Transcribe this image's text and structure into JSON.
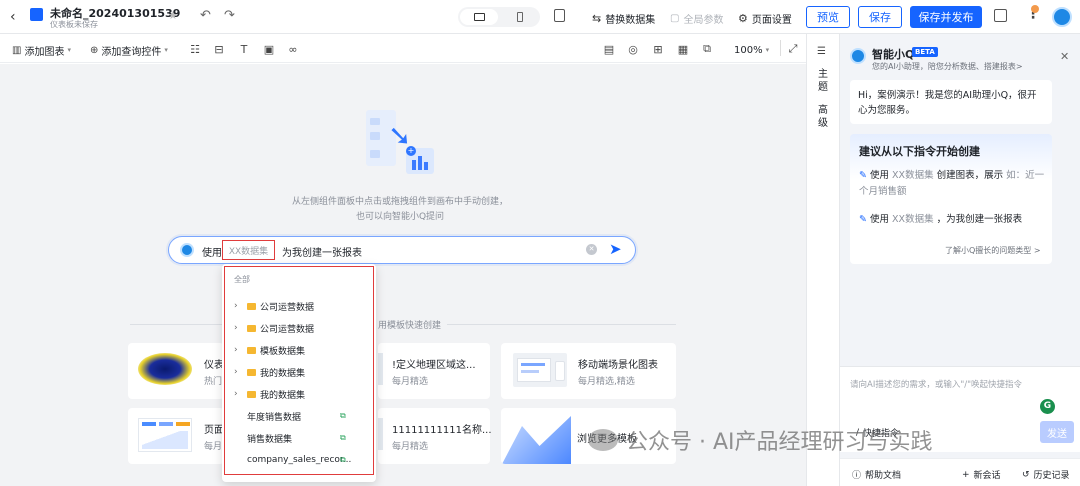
{
  "header": {
    "title": "未命名_202401301539",
    "subtitle": "仪表板未保存",
    "replace_dataset": "替换数据集",
    "global_params": "全局参数",
    "page_settings": "页面设置",
    "preview": "预览",
    "save": "保存",
    "save_publish": "保存并发布"
  },
  "toolbar": {
    "add_chart": "添加图表",
    "add_query": "添加查询控件",
    "zoom": "100%"
  },
  "canvas": {
    "hint_line1": "从左侧组件面板中点击或拖拽组件到画布中手动创建，",
    "hint_line2": "也可以向智能小Q提问",
    "prompt_prefix": "使用",
    "prompt_placeholder": "XX数据集",
    "prompt_suffix": "为我创建一张报表",
    "template_header": "用模板快速创建"
  },
  "dropdown": {
    "header": "全部",
    "items": [
      {
        "label": "公司运营数据",
        "type": "folder"
      },
      {
        "label": "公司运营数据",
        "type": "folder"
      },
      {
        "label": "模板数据集",
        "type": "folder"
      },
      {
        "label": "我的数据集",
        "type": "folder"
      },
      {
        "label": "我的数据集",
        "type": "folder"
      },
      {
        "label": "年度销售数据",
        "type": "table"
      },
      {
        "label": "销售数据集",
        "type": "table"
      },
      {
        "label": "company_sales_recor...",
        "type": "table"
      }
    ]
  },
  "templates": [
    {
      "title": "仪表",
      "sub": "热门"
    },
    {
      "title": "!定义地理区域这...",
      "sub": "每月精选"
    },
    {
      "title": "移动端场景化图表",
      "sub": "每月精选,精选"
    },
    {
      "title": "页面",
      "sub": "每月"
    },
    {
      "title": "11111111111名称...",
      "sub": "每月精选"
    },
    {
      "title": "浏览更多模板",
      "sub": ""
    }
  ],
  "sidebar": {
    "theme": "主题",
    "advanced": "高级"
  },
  "assistant": {
    "title": "智能小Q",
    "badge": "BETA",
    "subtitle": "您的AI小助理，陪您分析数据、搭建报表>",
    "greeting": "Hi，案例演示！我是您的AI助理小Q，很开心为您服务。",
    "suggest_title": "建议从以下指令开始创建",
    "suggest1_prefix": "使用",
    "suggest1_dataset": "XX数据集",
    "suggest1_mid": "创建图表，展示",
    "suggest1_hint": "如：近一个月销售额",
    "suggest2_prefix": "使用",
    "suggest2_dataset": "XX数据集",
    "suggest2_mid": "，为我创建一张报表",
    "learn_more": "了解小Q擅长的问题类型 >",
    "input_placeholder": "请向AI描述您的需求，或输入\"/\"唤起快捷指令",
    "shortcut": "快捷指令",
    "send": "发送",
    "help": "帮助文档",
    "new_chat": "新会话",
    "history": "历史记录"
  },
  "watermark": "公众号 · AI产品经理研习与实践",
  "colors": {
    "primary": "#1664ff",
    "highlight": "#e03c3c",
    "folder": "#f5b731",
    "table": "#2aa35d"
  }
}
